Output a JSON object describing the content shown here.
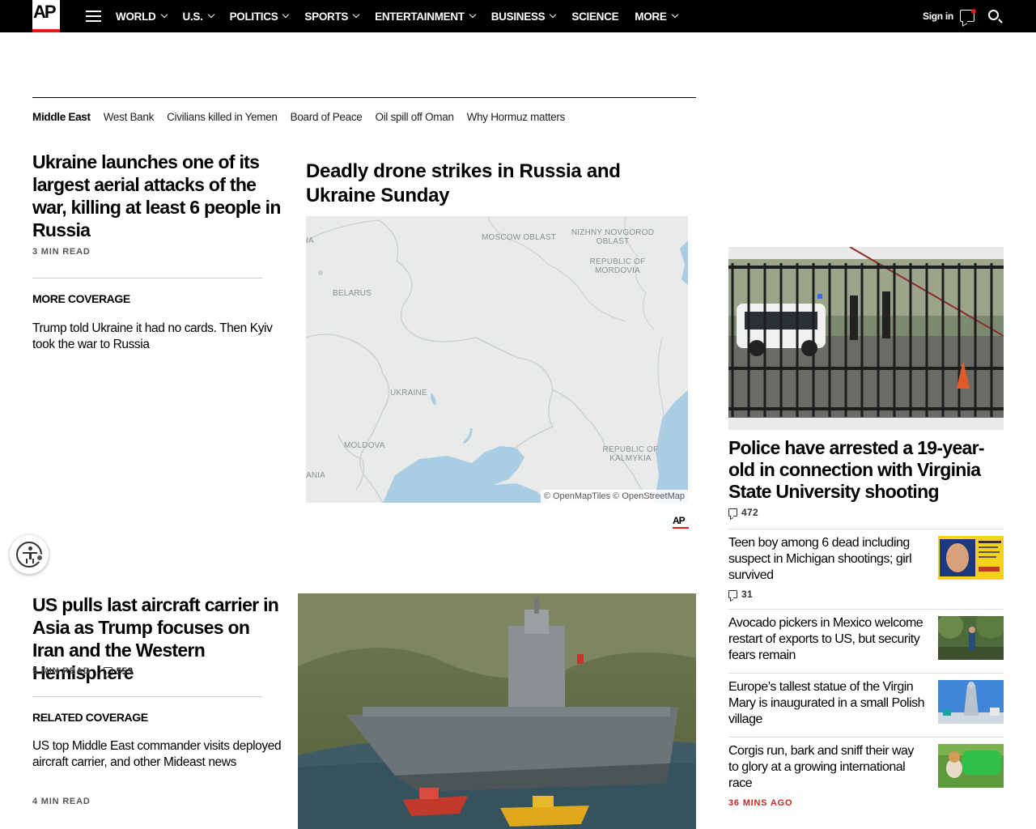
{
  "nav": {
    "logo": "AP",
    "items": [
      {
        "label": "WORLD",
        "dropdown": true
      },
      {
        "label": "U.S.",
        "dropdown": true
      },
      {
        "label": "POLITICS",
        "dropdown": true
      },
      {
        "label": "SPORTS",
        "dropdown": true
      },
      {
        "label": "ENTERTAINMENT",
        "dropdown": true
      },
      {
        "label": "BUSINESS",
        "dropdown": true
      },
      {
        "label": "SCIENCE",
        "dropdown": false
      },
      {
        "label": "MORE",
        "dropdown": true
      }
    ],
    "signin": "Sign in"
  },
  "topics": [
    "Middle East",
    "West Bank",
    "Civilians killed in Yemen",
    "Board of Peace",
    "Oil spill off Oman",
    "Why Hormuz matters"
  ],
  "lead": {
    "title": "Ukraine launches one of its largest aerial attacks of the war, killing at least 6 people in Russia",
    "read_time": "3 MIN READ",
    "more_label": "MORE COVERAGE",
    "more_link": "Trump told Ukraine it had no cards. Then Kyiv took the war to Russia"
  },
  "map_block": {
    "title": "Deadly drone strikes in Russia and Ukraine Sunday",
    "labels": {
      "moscow": "MOSCOW OBLAST",
      "nizhny": "NIZHNY NOVGOROD OBLAST",
      "mordovia": "REPUBLIC OF MORDOVIA",
      "belarus": "BELARUS",
      "ukraine": "UKRAINE",
      "moldova": "MOLDOVA",
      "kalmykia": "REPUBLIC OF KALMYKIA",
      "ania": "ANIA",
      "ia": "IA"
    },
    "attribution": "© OpenMapTiles © OpenStreetMap",
    "credit": "AP"
  },
  "carrier": {
    "title": "US pulls last aircraft carrier in Asia as Trump focuses on Iran and the Western Hemisphere",
    "read_time": "5 MIN READ",
    "comments": "553",
    "related_label": "RELATED COVERAGE",
    "related_link": "US top Middle East commander visits deployed aircraft carrier, and other Mideast news",
    "related_read_time": "4 MIN READ"
  },
  "rail": {
    "top_title": "Police have arrested a 19-year-old in connection with Virginia State University shooting",
    "top_comments": "472",
    "items": [
      {
        "title": "Teen boy among 6 dead including suspect in Michigan shootings; girl survived",
        "comments": "31"
      },
      {
        "title": "Avocado pickers in Mexico welcome restart of exports to US, but security fears remain"
      },
      {
        "title": "Europe’s tallest statue of the Virgin Mary is inaugurated in a small Polish village"
      },
      {
        "title": "Corgis run, bark and sniff their way to glory at a growing international race",
        "time": "36 MINS AGO"
      }
    ]
  },
  "colors": {
    "accent_red": "#e21b1b",
    "time_red": "#c62828",
    "nav_bg": "#000000",
    "map_water": "#a9cde3",
    "map_land": "#e9ebeb"
  }
}
